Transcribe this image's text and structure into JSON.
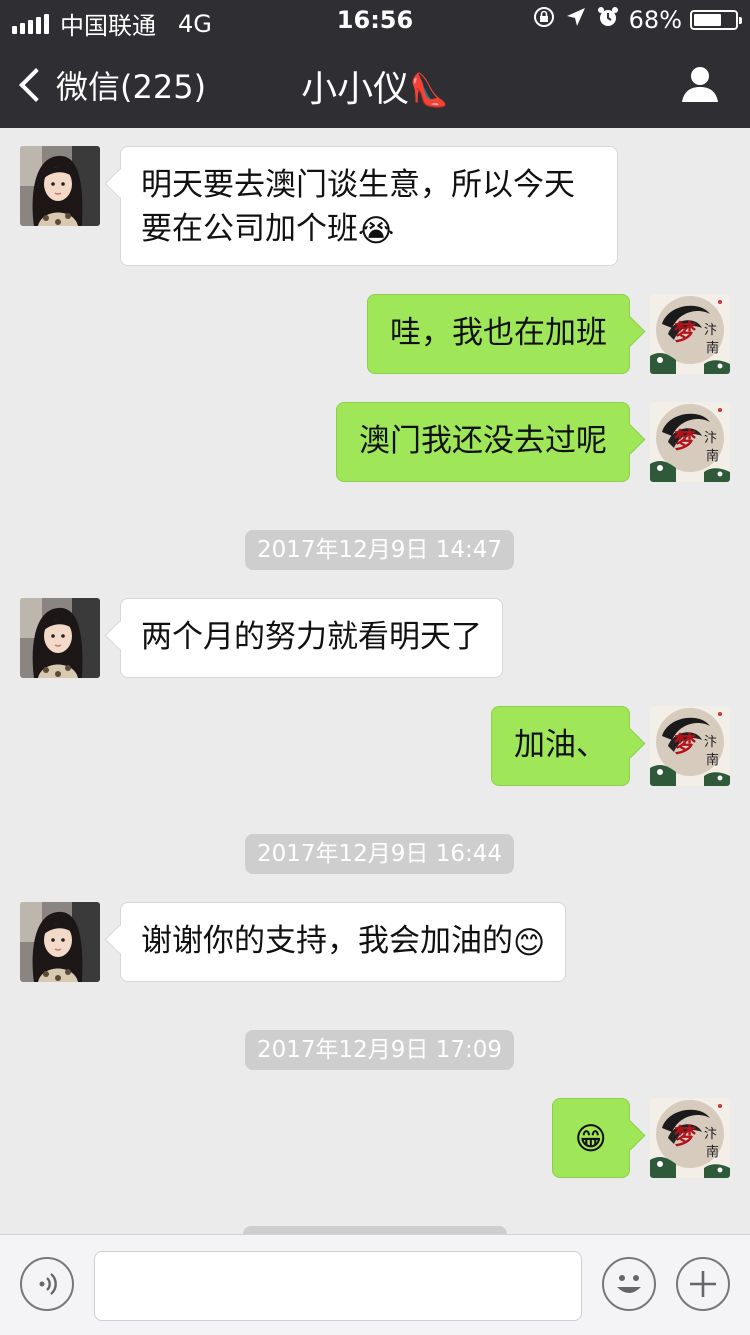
{
  "status_bar": {
    "carrier": "中国联通",
    "network": "4G",
    "time": "16:56",
    "battery_percent": "68%",
    "battery_level": 0.68
  },
  "nav": {
    "back_label": "微信(225)",
    "contact_name": "小小仪",
    "title_emoji": "👠"
  },
  "messages": [
    {
      "text_line1": "明天要去澳门谈生意，所以今天",
      "text_line2": "要在公司加个班",
      "emoji": "😭"
    },
    {
      "text": "哇，我也在加班"
    },
    {
      "text": "澳门我还没去过呢"
    },
    {
      "text": "两个月的努力就看明天了"
    },
    {
      "text": "加油、"
    },
    {
      "text": "谢谢你的支持，我会加油的",
      "emoji": "😊"
    },
    {
      "emoji": "😁"
    }
  ],
  "timestamps": [
    "2017年12月9日 14:47",
    "2017年12月9日 16:44",
    "2017年12月9日 17:09"
  ],
  "colors": {
    "nav_bg": "#2e2e33",
    "chat_bg": "#ebebeb",
    "outgoing_bubble": "#9fe658",
    "incoming_bubble": "#ffffff",
    "timestamp_bg": "#cecece"
  },
  "input_bar": {
    "voice_icon": "voice-icon",
    "emoji_icon": "emoji-icon",
    "plus_icon": "plus-icon"
  }
}
